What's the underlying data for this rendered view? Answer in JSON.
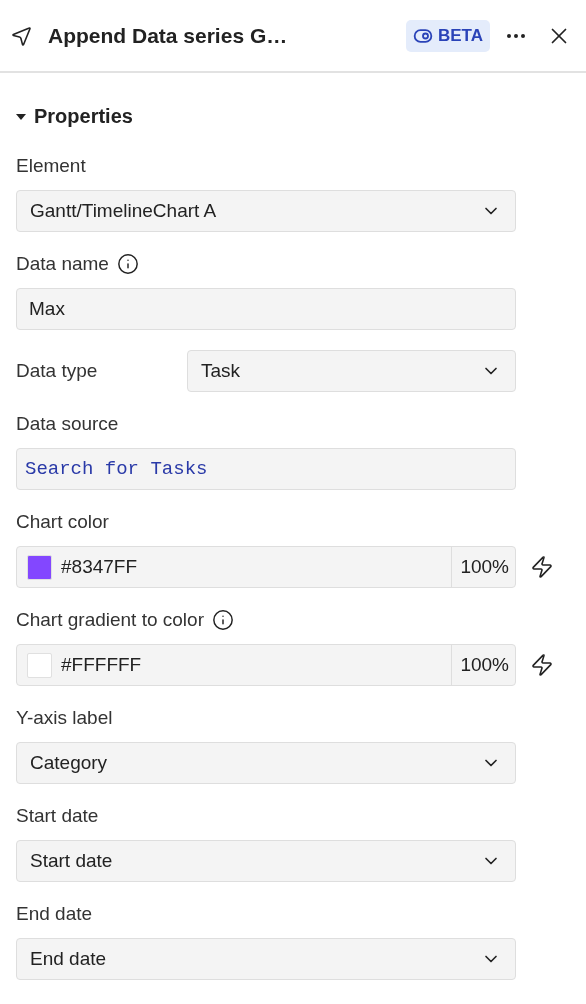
{
  "header": {
    "title": "Append Data series G…",
    "badge": "BETA"
  },
  "section": {
    "title": "Properties",
    "expanded": true
  },
  "fields": [
    {
      "kind": "select",
      "label": "Element",
      "value": "Gantt/TimelineChart A"
    },
    {
      "kind": "text",
      "label": "Data name",
      "info": true,
      "value": "Max"
    },
    {
      "kind": "inline-select",
      "label": "Data type",
      "value": "Task"
    },
    {
      "kind": "search",
      "label": "Data source",
      "placeholder": "Search for Tasks"
    },
    {
      "kind": "color",
      "label": "Chart color",
      "color": "#8347ff",
      "value": "#8347FF",
      "opacity": "100%"
    },
    {
      "kind": "color",
      "label": "Chart gradient to color",
      "info": true,
      "color": "#ffffff",
      "value": "#FFFFFF",
      "opacity": "100%"
    },
    {
      "kind": "select",
      "label": "Y-axis label",
      "value": "Category"
    },
    {
      "kind": "select",
      "label": "Start date",
      "value": "Start date"
    },
    {
      "kind": "select",
      "label": "End date",
      "value": "End date"
    }
  ]
}
